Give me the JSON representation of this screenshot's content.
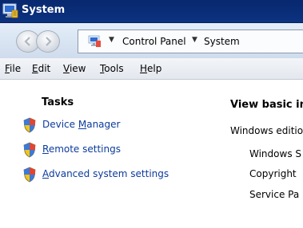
{
  "window": {
    "title": "System"
  },
  "address_bar": {
    "crumbs": [
      "Control Panel",
      "System"
    ]
  },
  "menu": {
    "items": [
      {
        "key": "F",
        "rest": "ile"
      },
      {
        "key": "E",
        "rest": "dit"
      },
      {
        "key": "V",
        "rest": "iew"
      },
      {
        "key": "T",
        "rest": "ools"
      },
      {
        "key": "H",
        "rest": "elp"
      }
    ]
  },
  "tasks": {
    "header": "Tasks",
    "links": [
      {
        "pre": "Device ",
        "key": "M",
        "post": "anager"
      },
      {
        "pre": "",
        "key": "R",
        "post": "emote settings"
      },
      {
        "pre": "",
        "key": "A",
        "post": "dvanced system settings"
      }
    ]
  },
  "content": {
    "heading": "View basic in",
    "edition_label": "Windows editio",
    "lines": [
      "Windows S",
      "Copyright",
      "Service Pa"
    ]
  },
  "colors": {
    "link": "#0b3b9c",
    "title_bar": "#08286f"
  }
}
